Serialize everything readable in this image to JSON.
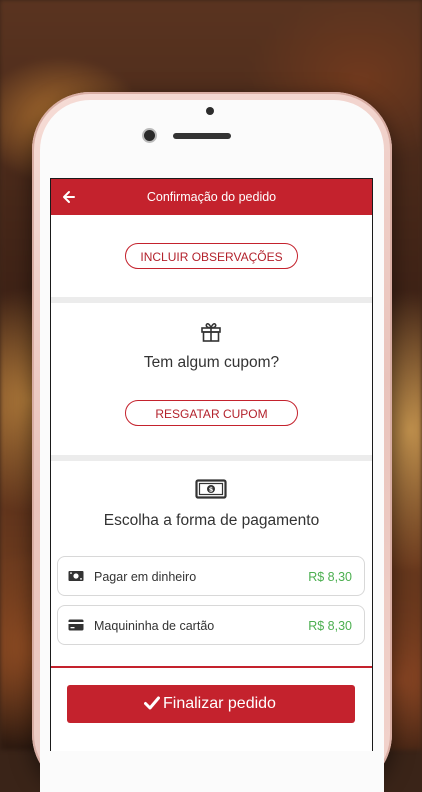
{
  "header": {
    "title": "Confirmação do pedido",
    "back_icon": "arrow-left-icon"
  },
  "observations": {
    "button_label": "INCLUIR OBSERVAÇÕES"
  },
  "coupon": {
    "icon": "gift-icon",
    "prompt": "Tem algum cupom?",
    "button_label": "RESGATAR CUPOM"
  },
  "payment": {
    "icon": "money-bill-icon",
    "prompt": "Escolha a forma de pagamento",
    "options": [
      {
        "icon": "cash-icon",
        "label": "Pagar em dinheiro",
        "price": "R$ 8,30"
      },
      {
        "icon": "credit-card-icon",
        "label": "Maquininha de cartão",
        "price": "R$ 8,30"
      }
    ]
  },
  "footer": {
    "finalize_label": "Finalizar pedido",
    "finalize_icon": "check-icon"
  },
  "colors": {
    "brand_red": "#c4222d",
    "price_green": "#4caf50"
  }
}
